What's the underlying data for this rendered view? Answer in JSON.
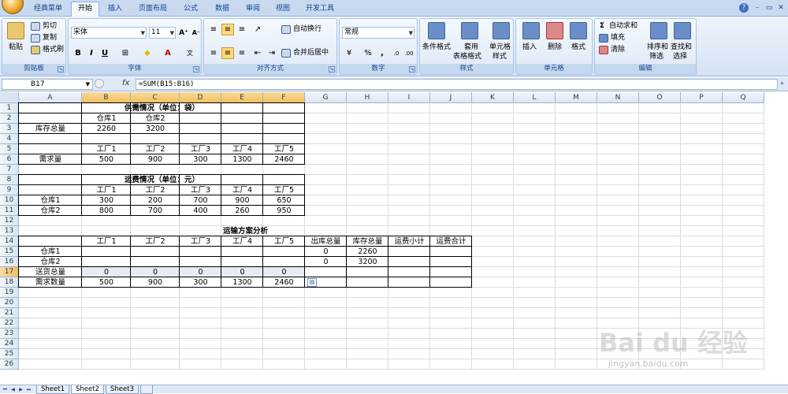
{
  "ribbon_tabs": [
    "经典菜单",
    "开始",
    "插入",
    "页面布局",
    "公式",
    "数据",
    "审阅",
    "视图",
    "开发工具"
  ],
  "active_tab": "开始",
  "clipboard": {
    "paste": "粘贴",
    "cut": "剪切",
    "copy": "复制",
    "format_painter": "格式刷",
    "label": "剪贴板"
  },
  "font": {
    "name": "宋体",
    "size": "11",
    "label": "字体"
  },
  "alignment": {
    "wrap": "自动换行",
    "merge": "合并后居中",
    "label": "对齐方式"
  },
  "number": {
    "format": "常规",
    "label": "数字"
  },
  "styles": {
    "conditional": "条件格式",
    "table_format_1": "套用",
    "table_format_2": "表格格式",
    "cell_style_1": "单元格",
    "cell_style_2": "样式",
    "label": "样式"
  },
  "cells": {
    "insert": "插入",
    "delete": "删除",
    "format": "格式",
    "label": "单元格"
  },
  "editing": {
    "autosum": "自动求和",
    "fill": "填充",
    "clear": "清除",
    "sort_1": "排序和",
    "sort_2": "筛选",
    "find_1": "查找和",
    "find_2": "选择",
    "label": "编辑"
  },
  "formula_bar": {
    "name_box": "B17",
    "fx": "fx",
    "formula": "=SUM(B15:B16)"
  },
  "columns": [
    "A",
    "B",
    "C",
    "D",
    "E",
    "F",
    "G",
    "H",
    "I",
    "J",
    "K",
    "L",
    "M",
    "N",
    "O",
    "P",
    "Q"
  ],
  "rows": [
    "1",
    "2",
    "3",
    "4",
    "5",
    "6",
    "7",
    "8",
    "9",
    "10",
    "11",
    "12",
    "13",
    "14",
    "15",
    "16",
    "17",
    "18",
    "19",
    "20",
    "21",
    "22",
    "23",
    "24",
    "25",
    "26"
  ],
  "sheet": {
    "title1": "供需情况（单位：袋）",
    "wh1": "仓库1",
    "wh2": "仓库2",
    "stock_label": "库存总量",
    "stock1": "2260",
    "stock2": "3200",
    "factories": [
      "工厂1",
      "工厂2",
      "工厂3",
      "工厂4",
      "工厂5"
    ],
    "demand_label": "需求量",
    "demand": [
      "500",
      "900",
      "300",
      "1300",
      "2460"
    ],
    "title2": "运费情况（单位：元）",
    "cost_wh1": [
      "300",
      "200",
      "700",
      "900",
      "650"
    ],
    "cost_wh2": [
      "800",
      "700",
      "400",
      "260",
      "950"
    ],
    "title3": "运输方案分析",
    "col_out": "出库总量",
    "col_stock": "库存总量",
    "col_sub": "运费小计",
    "col_total": "运费合计",
    "out1": "0",
    "out2": "0",
    "st1": "2260",
    "st2": "3200",
    "send_label": "送货总量",
    "send": [
      "0",
      "0",
      "0",
      "0",
      "0"
    ],
    "need_label": "需求数量",
    "need": [
      "500",
      "900",
      "300",
      "1300",
      "2460"
    ]
  },
  "sheet_tabs": [
    "Sheet1",
    "Sheet2",
    "Sheet3"
  ],
  "active_sheet": "Sheet2",
  "watermark": {
    "logo": "Bai du 经验",
    "url": "jingyan.baidu.com"
  }
}
